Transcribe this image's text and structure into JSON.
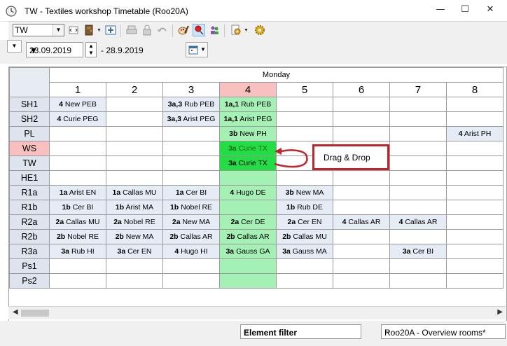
{
  "window": {
    "title": "TW - Textiles workshop  Timetable  (Roo20A)"
  },
  "toolbar": {
    "element_value": "TW"
  },
  "dates": {
    "start": "23.09.2019",
    "end": "- 28.9.2019"
  },
  "timetable": {
    "day": "Monday",
    "periods": [
      "1",
      "2",
      "3",
      "4",
      "5",
      "6",
      "7",
      "8"
    ],
    "rows": [
      {
        "label": "SH1",
        "cells": [
          [
            "4",
            "New PEB"
          ],
          [
            "",
            ""
          ],
          [
            "3a,3",
            "Rub PEB"
          ],
          [
            "1a,1",
            "Rub PEB"
          ],
          [
            "",
            ""
          ],
          [
            "",
            ""
          ],
          [
            "",
            ""
          ],
          [
            "",
            ""
          ]
        ]
      },
      {
        "label": "SH2",
        "cells": [
          [
            "4",
            "Curie PEG"
          ],
          [
            "",
            ""
          ],
          [
            "3a,3",
            "Arist PEG"
          ],
          [
            "1a,1",
            "Arist PEG"
          ],
          [
            "",
            ""
          ],
          [
            "",
            ""
          ],
          [
            "",
            ""
          ],
          [
            "",
            ""
          ]
        ]
      },
      {
        "label": "PL",
        "cells": [
          [
            "",
            ""
          ],
          [
            "",
            ""
          ],
          [
            "",
            ""
          ],
          [
            "3b",
            "New PH"
          ],
          [
            "",
            ""
          ],
          [
            "",
            ""
          ],
          [
            "",
            ""
          ],
          [
            "4",
            "Arist PH"
          ]
        ]
      },
      {
        "label": "WS",
        "cells": [
          [
            "",
            ""
          ],
          [
            "",
            ""
          ],
          [
            "",
            ""
          ],
          [
            "3a",
            "Curie TX"
          ],
          [
            "",
            ""
          ],
          [
            "",
            ""
          ],
          [
            "",
            ""
          ],
          [
            "",
            ""
          ]
        ]
      },
      {
        "label": "TW",
        "cells": [
          [
            "",
            ""
          ],
          [
            "",
            ""
          ],
          [
            "",
            ""
          ],
          [
            "3a",
            "Curie TX"
          ],
          [
            "",
            ""
          ],
          [
            "",
            ""
          ],
          [
            "",
            ""
          ],
          [
            "",
            ""
          ]
        ]
      },
      {
        "label": "HE1",
        "cells": [
          [
            "",
            ""
          ],
          [
            "",
            ""
          ],
          [
            "",
            ""
          ],
          [
            "",
            ""
          ],
          [
            "",
            ""
          ],
          [
            "",
            ""
          ],
          [
            "",
            ""
          ],
          [
            "",
            ""
          ]
        ]
      },
      {
        "label": "R1a",
        "cells": [
          [
            "1a",
            "Arist EN"
          ],
          [
            "1a",
            "Callas MU"
          ],
          [
            "1a",
            "Cer BI"
          ],
          [
            "4",
            "Hugo DE"
          ],
          [
            "3b",
            "New MA"
          ],
          [
            "",
            ""
          ],
          [
            "",
            ""
          ],
          [
            "",
            ""
          ]
        ]
      },
      {
        "label": "R1b",
        "cells": [
          [
            "1b",
            "Cer BI"
          ],
          [
            "1b",
            "Arist MA"
          ],
          [
            "1b",
            "Nobel RE"
          ],
          [
            "",
            ""
          ],
          [
            "1b",
            "Rub DE"
          ],
          [
            "",
            ""
          ],
          [
            "",
            ""
          ],
          [
            "",
            ""
          ]
        ]
      },
      {
        "label": "R2a",
        "cells": [
          [
            "2a",
            "Callas MU"
          ],
          [
            "2a",
            "Nobel RE"
          ],
          [
            "2a",
            "New MA"
          ],
          [
            "2a",
            "Cer DE"
          ],
          [
            "2a",
            "Cer EN"
          ],
          [
            "4",
            "Callas AR"
          ],
          [
            "4",
            "Callas AR"
          ],
          [
            "",
            ""
          ]
        ]
      },
      {
        "label": "R2b",
        "cells": [
          [
            "2b",
            "Nobel RE"
          ],
          [
            "2b",
            "New MA"
          ],
          [
            "2b",
            "Callas AR"
          ],
          [
            "2b",
            "Callas AR"
          ],
          [
            "2b",
            "Callas MU"
          ],
          [
            "",
            ""
          ],
          [
            "",
            ""
          ],
          [
            "",
            ""
          ]
        ]
      },
      {
        "label": "R3a",
        "cells": [
          [
            "3a",
            "Rub HI"
          ],
          [
            "3a",
            "Cer EN"
          ],
          [
            "4",
            "Hugo HI"
          ],
          [
            "3a",
            "Gauss GA"
          ],
          [
            "3a",
            "Gauss MA"
          ],
          [
            "",
            ""
          ],
          [
            "3a",
            "Cer BI"
          ],
          [
            "",
            ""
          ]
        ]
      },
      {
        "label": "Ps1",
        "cells": [
          [
            "",
            ""
          ],
          [
            "",
            ""
          ],
          [
            "",
            ""
          ],
          [
            "",
            ""
          ],
          [
            "",
            ""
          ],
          [
            "",
            ""
          ],
          [
            "",
            ""
          ],
          [
            "",
            ""
          ]
        ]
      },
      {
        "label": "Ps2",
        "cells": [
          [
            "",
            ""
          ],
          [
            "",
            ""
          ],
          [
            "",
            ""
          ],
          [
            "",
            ""
          ],
          [
            "",
            ""
          ],
          [
            "",
            ""
          ],
          [
            "",
            ""
          ],
          [
            "",
            ""
          ]
        ]
      }
    ],
    "selected_period": "4",
    "selected_row": "WS"
  },
  "callout": {
    "label": "Drag & Drop"
  },
  "status": {
    "filter": "Element filter",
    "view": "Roo20A - Overview rooms*"
  },
  "colors": {
    "lesson_bg": "#e6ecf5",
    "highlight_column": "#a5f0b5",
    "moved_lesson": "#22dd44",
    "selected_header": "#f9c0c0",
    "callout_border": "#c0232a"
  }
}
